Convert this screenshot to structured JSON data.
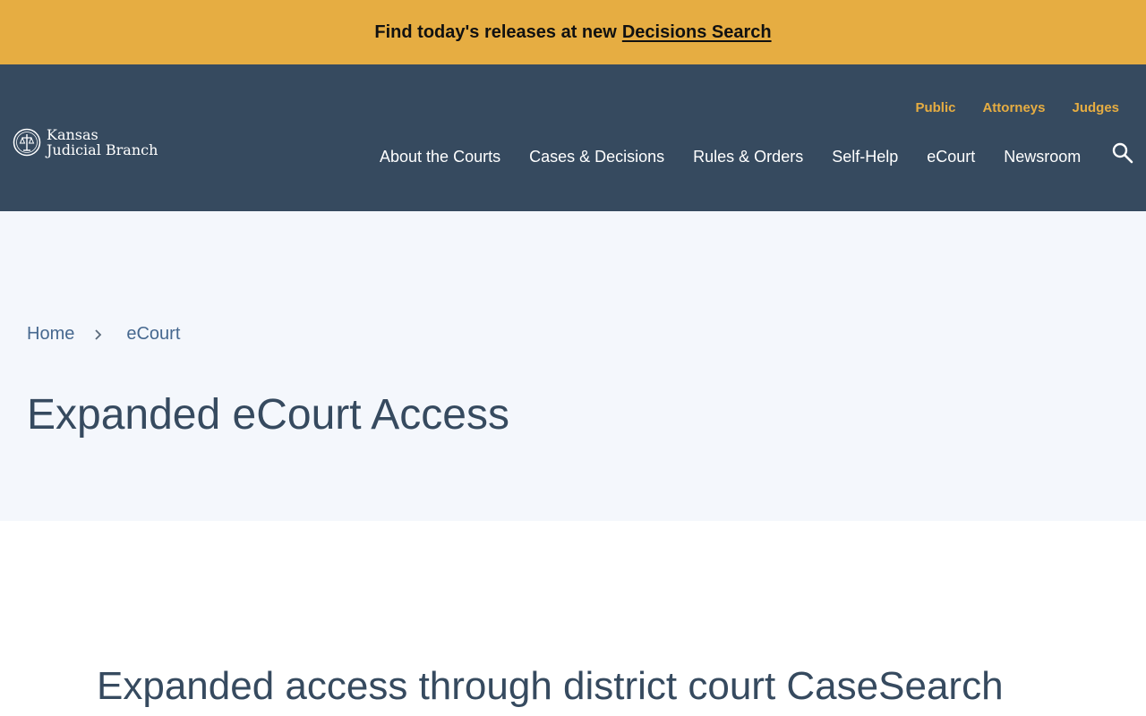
{
  "alert": {
    "text": "Find today's releases at new",
    "link_label": "Decisions Search"
  },
  "logo": {
    "line1": "Kansas",
    "line2": "Judicial Branch",
    "icon": "seal-icon"
  },
  "utility_nav": {
    "items": [
      {
        "label": "Public"
      },
      {
        "label": "Attorneys"
      },
      {
        "label": "Judges"
      }
    ]
  },
  "main_nav": {
    "items": [
      {
        "label": "About the Courts"
      },
      {
        "label": "Cases & Decisions"
      },
      {
        "label": "Rules & Orders"
      },
      {
        "label": "Self-Help"
      },
      {
        "label": "eCourt"
      },
      {
        "label": "Newsroom"
      }
    ],
    "search_icon": "search-icon"
  },
  "breadcrumb": {
    "items": [
      {
        "label": "Home"
      },
      {
        "label": "eCourt"
      }
    ],
    "separator_icon": "chevron-right-icon"
  },
  "page": {
    "title": "Expanded eCourt Access",
    "section_heading": "Expanded access through district court CaseSearch"
  },
  "colors": {
    "alert_bg": "#e6ad42",
    "header_bg": "#364a5f",
    "accent": "#e6ad42",
    "hero_bg": "#f4f7fc",
    "heading_text": "#364a5f",
    "link": "#46688f"
  }
}
